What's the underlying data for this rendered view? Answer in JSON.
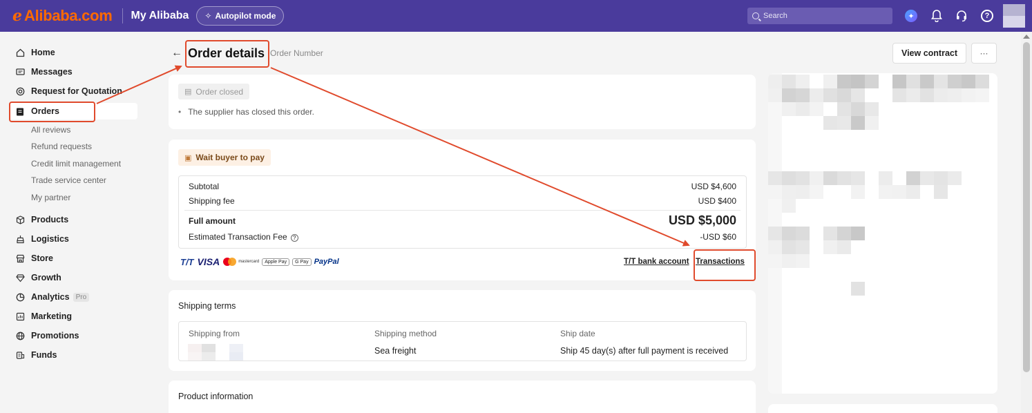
{
  "topbar": {
    "logo_text": "Alibaba.com",
    "my_alibaba": "My Alibaba",
    "autopilot_label": "Autopilot mode",
    "search_placeholder": "Search",
    "background_color": "#4a3b9c",
    "brand_color": "#ff6a00",
    "icons": [
      "ai-assistant-icon",
      "bell-icon",
      "headset-icon",
      "question-icon",
      "avatar"
    ]
  },
  "sidebar": {
    "items": [
      {
        "label": "Home",
        "icon": "home-icon"
      },
      {
        "label": "Messages",
        "icon": "message-icon"
      },
      {
        "label": "Request for Quotation",
        "icon": "target-icon"
      },
      {
        "label": "Orders",
        "icon": "clipboard-icon",
        "active": true
      },
      {
        "label": "Products",
        "icon": "cube-icon"
      },
      {
        "label": "Logistics",
        "icon": "truck-icon"
      },
      {
        "label": "Store",
        "icon": "store-icon"
      },
      {
        "label": "Growth",
        "icon": "diamond-icon"
      },
      {
        "label": "Analytics",
        "icon": "chart-pie-icon",
        "badge": "Pro"
      },
      {
        "label": "Marketing",
        "icon": "marketing-icon"
      },
      {
        "label": "Promotions",
        "icon": "globe-icon"
      },
      {
        "label": "Funds",
        "icon": "coins-icon"
      }
    ],
    "orders_sub": [
      "All reviews",
      "Refund requests",
      "Credit limit management",
      "Trade service center",
      "My partner"
    ]
  },
  "header": {
    "title": "Order details",
    "order_number_label": "Order Number",
    "view_contract": "View contract",
    "more": "···"
  },
  "status_card": {
    "chip": "Order closed",
    "note": "The supplier has closed this order."
  },
  "payment_card": {
    "chip": "Wait buyer to pay",
    "subtotal_label": "Subtotal",
    "subtotal_value": "USD $4,600",
    "shipping_fee_label": "Shipping fee",
    "shipping_fee_value": "USD $400",
    "full_amount_label": "Full amount",
    "full_amount_value": "USD $5,000",
    "transaction_fee_label": "Estimated Transaction Fee",
    "transaction_fee_value": "-USD $60",
    "payment_methods": [
      "T/T",
      "VISA",
      "mastercard",
      "Apple Pay",
      "G Pay",
      "PayPal"
    ],
    "tt_bank_link": "T/T bank account",
    "transactions_link": "Transactions"
  },
  "shipping_card": {
    "heading": "Shipping terms",
    "col_from": "Shipping from",
    "col_method": "Shipping method",
    "col_date": "Ship date",
    "method_value": "Sea freight",
    "date_value": "Ship 45 day(s) after full payment is received"
  },
  "product_card": {
    "heading": "Product information"
  },
  "annotation_color": "#e04a2c"
}
